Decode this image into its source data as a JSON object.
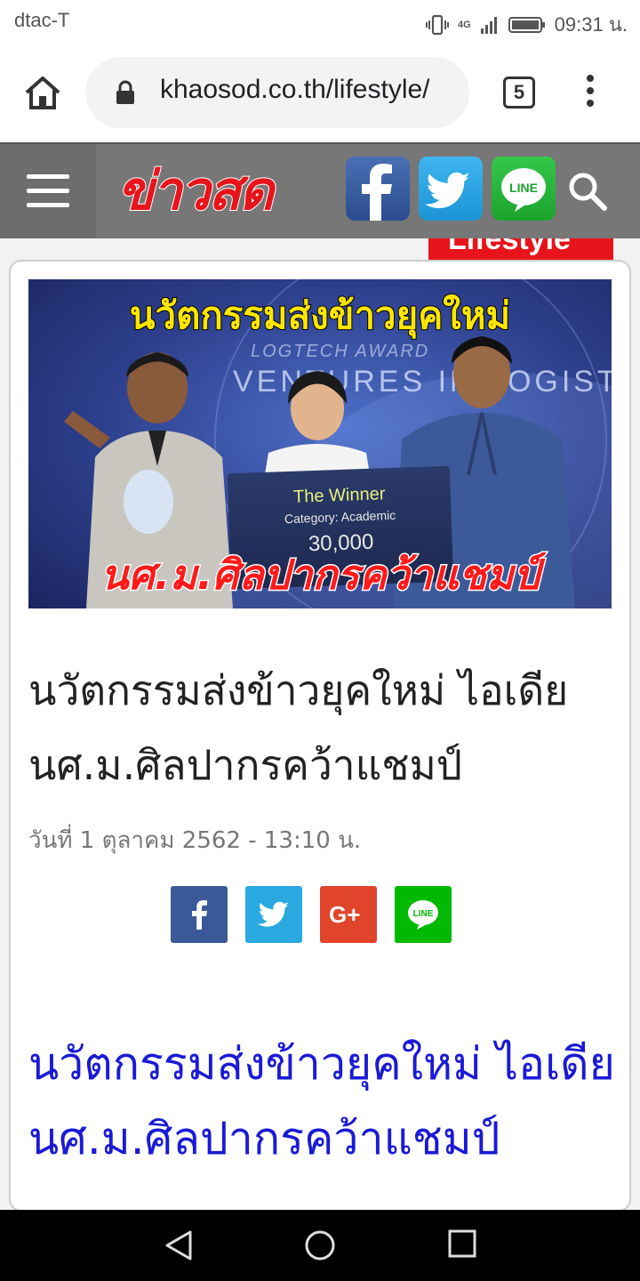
{
  "status_bar": {
    "carrier": "dtac-T",
    "network": "4G",
    "time": "09:31 น."
  },
  "browser": {
    "url": "khaosod.co.th/lifestyle/",
    "tab_count": "5"
  },
  "site": {
    "logo_text": "ข่าวสด",
    "section_label": "Lifestyle",
    "social_icons": [
      "facebook-icon",
      "twitter-icon",
      "line-icon"
    ]
  },
  "hero_image": {
    "headline": "นวัตกรรมส่งข้าวยุคใหม่",
    "subheadline": "นศ.ม.ศิลปากรคว้าแชมป์",
    "background_text": "VENTURES IN LOGISTICS",
    "background_text_2": "LOGTECH AWARD",
    "board_title": "The Winner",
    "board_category": "Category: Academic",
    "board_amount": "30,000"
  },
  "article": {
    "title": "นวัตกรรมส่งข้าวยุคใหม่ ไอเดียนศ.ม.ศิลปากรคว้าแชมป์",
    "date": "วันที่ 1 ตุลาคม 2562 - 13:10 น.",
    "share_buttons": [
      "facebook",
      "twitter",
      "google-plus",
      "line"
    ],
    "body_heading": "นวัตกรรมส่งข้าวยุคใหม่ ไอเดียนศ.ม.ศิลปากรคว้าแชมป์"
  },
  "colors": {
    "brand_red": "#e8141b",
    "link_blue": "#1a1ad6",
    "facebook": "#3b5998",
    "twitter": "#2aa9e0",
    "google_plus": "#e0442a",
    "line": "#00b900"
  }
}
